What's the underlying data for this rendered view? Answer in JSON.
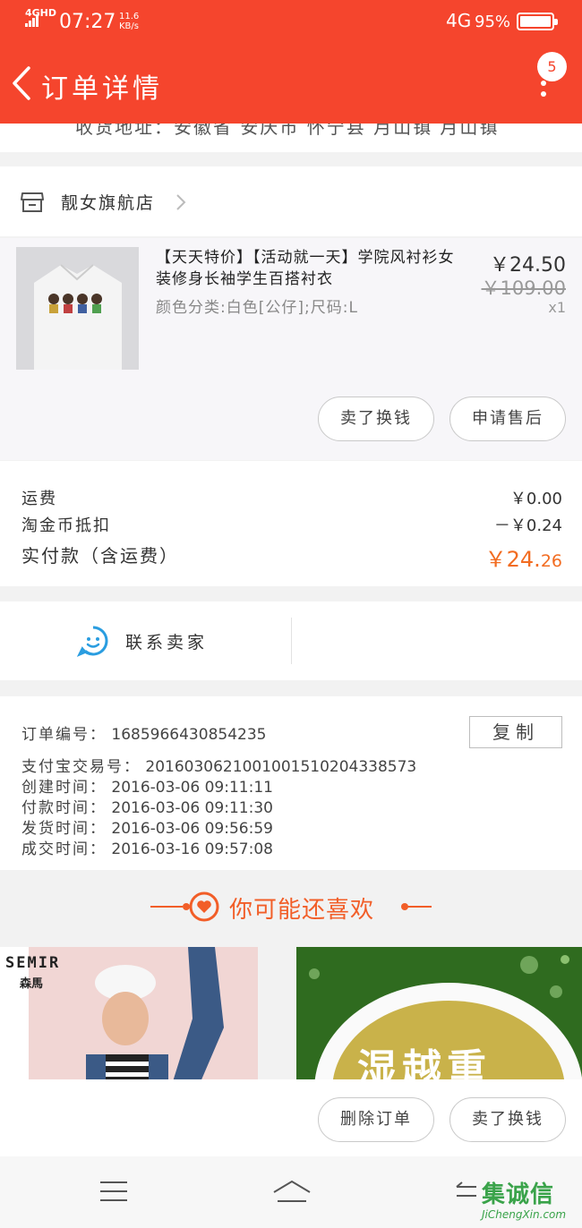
{
  "status_bar": {
    "signal": "4GHD",
    "time": "07:27",
    "speed_value": "11.6",
    "speed_unit": "KB/s",
    "network": "4G",
    "battery": "95%"
  },
  "header": {
    "title": "订单详情",
    "badge_count": "5"
  },
  "address_strip": "收货地址：安徽省 安庆市 怀宁县 月山镇 月山镇",
  "shop": {
    "name": "靓女旗航店"
  },
  "item": {
    "title": "【天天特价】【活动就一天】学院风衬衫女装修身长袖学生百搭衬衣",
    "sku": "颜色分类:白色[公仔];尺码:L",
    "price": "￥24.50",
    "original_price": "￥109.00",
    "quantity": "x1",
    "buttons": {
      "resell": "卖了换钱",
      "after_sale": "申请售后"
    }
  },
  "cost": {
    "shipping_label": "运费",
    "shipping_value": "￥0.00",
    "coin_label": "淘金币抵扣",
    "coin_value": "－￥0.24",
    "total_label": "实付款（含运费）",
    "total_symbol": "￥",
    "total_int": "24.",
    "total_dec": "26"
  },
  "contact": {
    "label": "联系卖家"
  },
  "order_info": {
    "copy_label": "复制",
    "rows": [
      {
        "key": "订单编号：",
        "value": "1685966430854235"
      },
      {
        "key": "支付宝交易号：",
        "value": "2016030621001001510204338573"
      },
      {
        "key": "创建时间：",
        "value": "2016-03-06 09:11:11"
      },
      {
        "key": "付款时间：",
        "value": "2016-03-06 09:11:30"
      },
      {
        "key": "发货时间：",
        "value": "2016-03-06 09:56:59"
      },
      {
        "key": "成交时间：",
        "value": "2016-03-16 09:57:08"
      }
    ]
  },
  "recommend": {
    "title": "你可能还喜欢",
    "card1_brand": "SEMIR",
    "card1_brand_zh": "森馬",
    "card2_text": "湿越重"
  },
  "bottom_actions": {
    "delete": "删除订单",
    "resell": "卖了换钱"
  },
  "watermark": {
    "zh": "集诚信",
    "en": "JiChengXin.com"
  },
  "colors": {
    "header": "#f5452d",
    "accent": "#f26c21",
    "contact_icon": "#2a9de0"
  }
}
